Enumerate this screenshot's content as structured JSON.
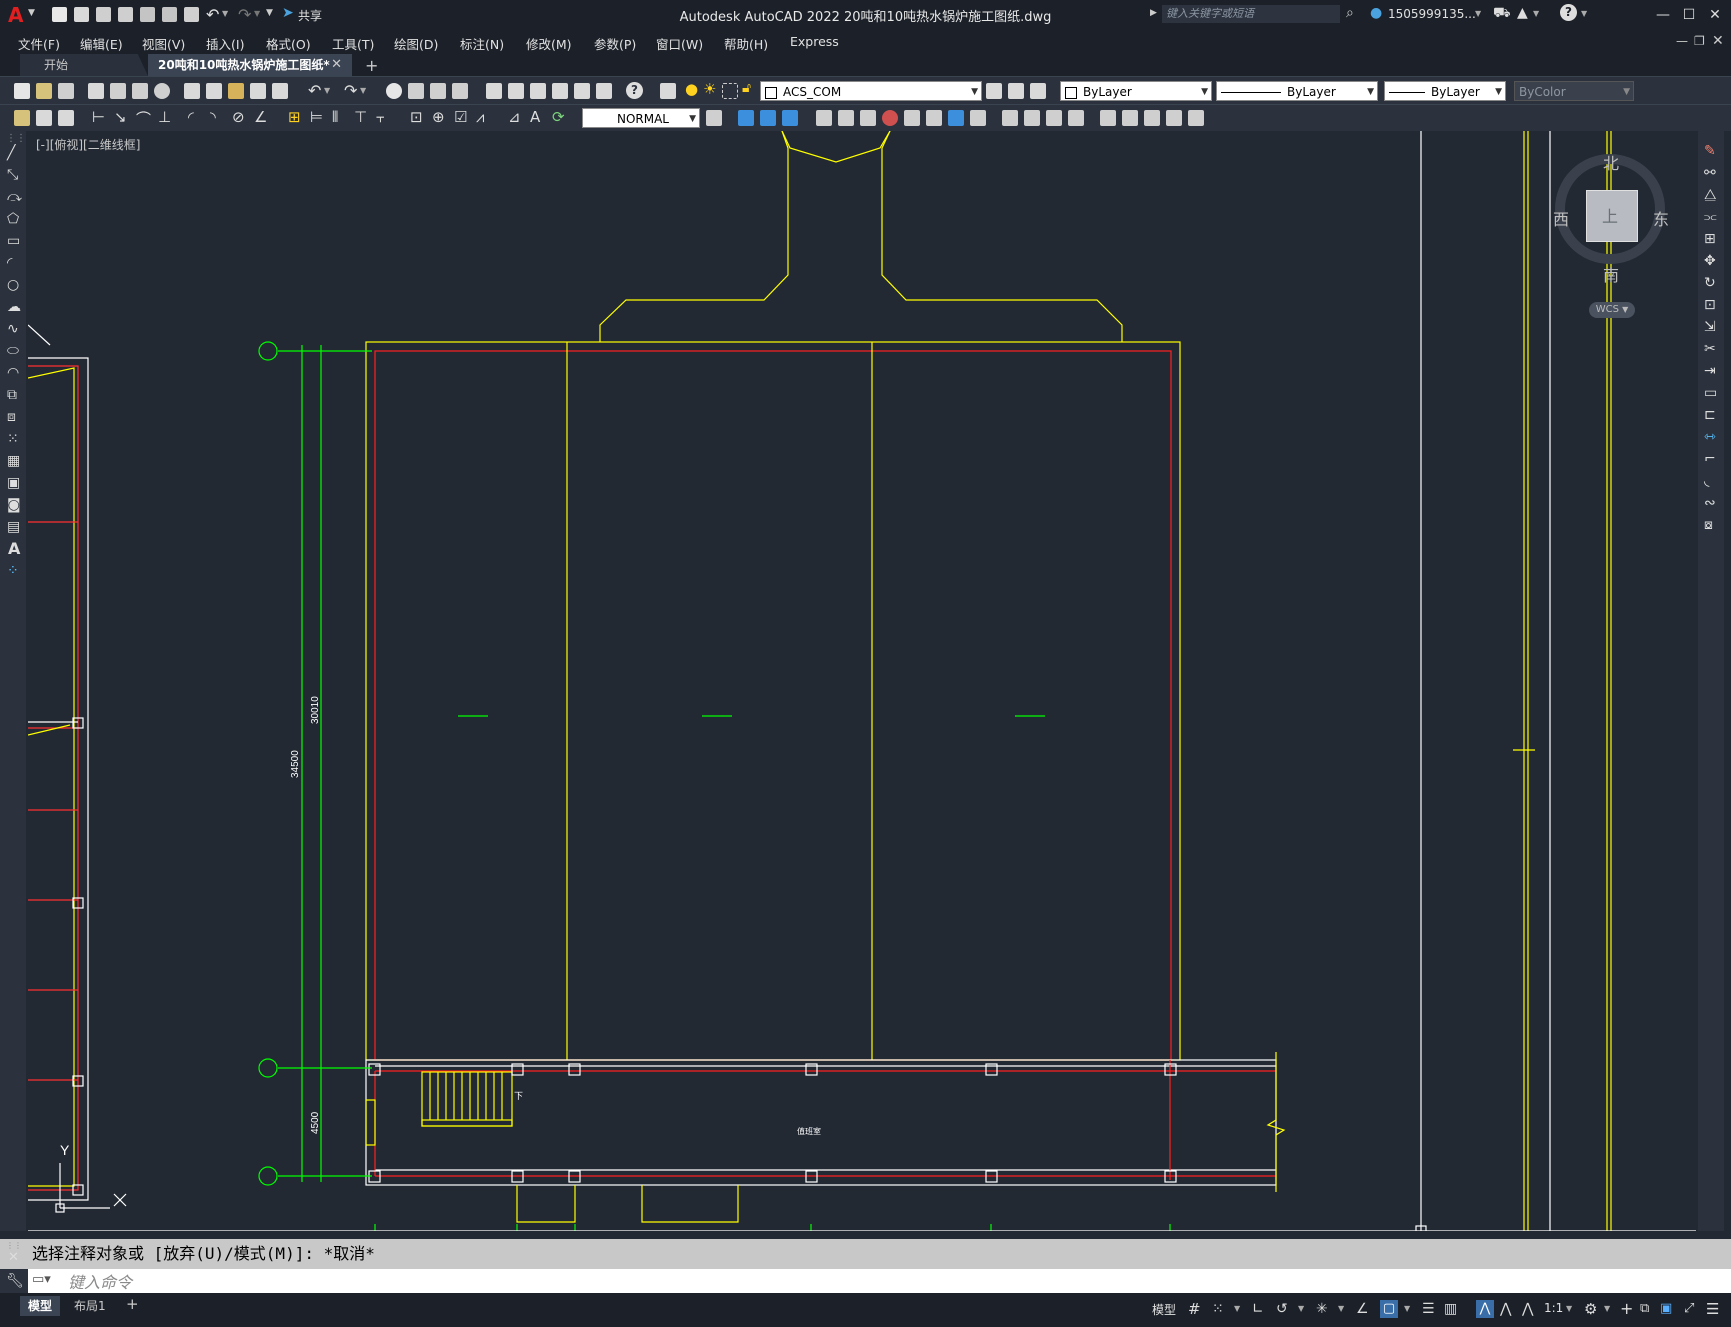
{
  "window": {
    "title": "Autodesk AutoCAD 2022    20吨和10吨热水锅炉施工图纸.dwg",
    "share_label": "共享",
    "search_placeholder": "键入关键字或短语",
    "user": "1505999135...",
    "colors": {
      "titlebar": "#1c2129",
      "canvas": "#222933",
      "accent_red": "#ff0000",
      "yellow": "#ffff00",
      "green": "#00ff00"
    }
  },
  "menu": {
    "items": [
      "文件(F)",
      "编辑(E)",
      "视图(V)",
      "插入(I)",
      "格式(O)",
      "工具(T)",
      "绘图(D)",
      "标注(N)",
      "修改(M)",
      "参数(P)",
      "窗口(W)",
      "帮助(H)",
      "Express"
    ]
  },
  "tabs": [
    {
      "label": "开始"
    },
    {
      "label": "20吨和10吨热水锅炉施工图纸*"
    }
  ],
  "toolbar": {
    "layer_value": "ACS_COM",
    "color_value": "ByLayer",
    "linetype_value": "ByLayer",
    "lineweight_value": "ByLayer",
    "plotstyle_value": "ByColor",
    "textstyle_value": "NORMAL"
  },
  "viewport": {
    "label": "[-][俯视][二维线框]"
  },
  "viewcube": {
    "north": "北",
    "south": "南",
    "east": "东",
    "west": "西",
    "top": "上",
    "wcs": "WCS"
  },
  "drawing": {
    "dim_total": "34500",
    "dim_upper": "30010",
    "dim_lower": "4500",
    "room_label": "值班室",
    "stair_label": "下",
    "axis_y": "Y"
  },
  "command": {
    "history": "选择注释对象或 [放弃(U)/模式(M)]: *取消*",
    "placeholder": "键入命令"
  },
  "status": {
    "model_tab": "模型",
    "layout_tab": "布局1",
    "model_button": "模型",
    "scale": "1:1"
  }
}
